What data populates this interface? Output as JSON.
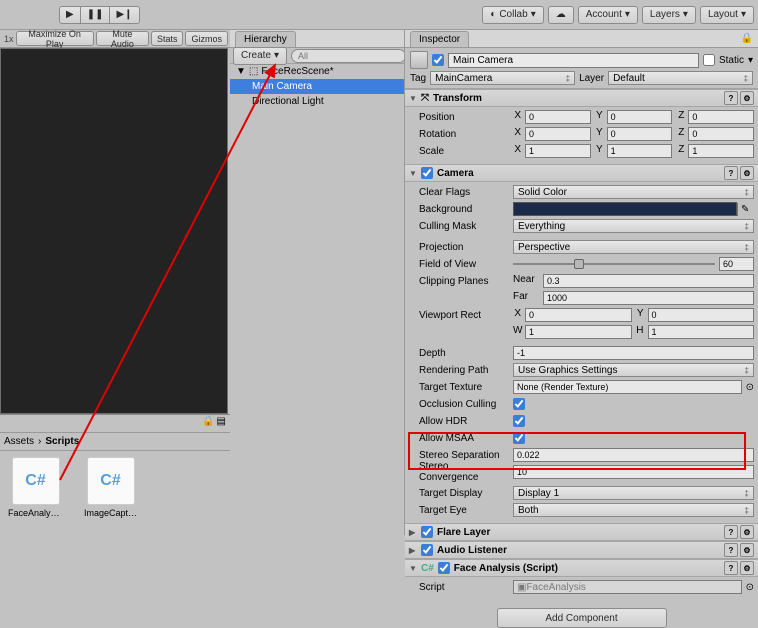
{
  "topbar": {
    "collab": "Collab",
    "account": "Account",
    "layers": "Layers",
    "layout": "Layout"
  },
  "gamebar": {
    "scale": "1x",
    "maximize": "Maximize On Play",
    "mute": "Mute Audio",
    "stats": "Stats",
    "gizmos": "Gizmos"
  },
  "hierarchy": {
    "tab": "Hierarchy",
    "create": "Create",
    "search_ph": "All",
    "scene": "FaceRecScene*",
    "items": [
      "Main Camera",
      "Directional Light"
    ]
  },
  "assets": {
    "crumb0": "Assets",
    "crumb1": "Scripts",
    "items": [
      "FaceAnalys…",
      "ImageCapt…"
    ]
  },
  "inspector": {
    "tab": "Inspector",
    "name": "Main Camera",
    "static": "Static",
    "tagLabel": "Tag",
    "tagValue": "MainCamera",
    "layerLabel": "Layer",
    "layerValue": "Default",
    "transform": {
      "title": "Transform",
      "posLabel": "Position",
      "pos": {
        "x": "0",
        "y": "0",
        "z": "0"
      },
      "rotLabel": "Rotation",
      "rot": {
        "x": "0",
        "y": "0",
        "z": "0"
      },
      "sclLabel": "Scale",
      "scl": {
        "x": "1",
        "y": "1",
        "z": "1"
      }
    },
    "camera": {
      "title": "Camera",
      "clearFlagsLabel": "Clear Flags",
      "clearFlags": "Solid Color",
      "backgroundLabel": "Background",
      "cullingLabel": "Culling Mask",
      "culling": "Everything",
      "projLabel": "Projection",
      "proj": "Perspective",
      "fovLabel": "Field of View",
      "fov": "60",
      "clipLabel": "Clipping Planes",
      "nearL": "Near",
      "near": "0.3",
      "farL": "Far",
      "far": "1000",
      "viewportLabel": "Viewport Rect",
      "vx": "0",
      "vy": "0",
      "vw": "1",
      "vh": "1",
      "depthLabel": "Depth",
      "depth": "-1",
      "renderPathLabel": "Rendering Path",
      "renderPath": "Use Graphics Settings",
      "targetTexLabel": "Target Texture",
      "targetTex": "None (Render Texture)",
      "occLabel": "Occlusion Culling",
      "hdrLabel": "Allow HDR",
      "msaaLabel": "Allow MSAA",
      "stereoSepLabel": "Stereo Separation",
      "stereoSep": "0.022",
      "stereoConvLabel": "Stereo Convergence",
      "stereoConv": "10",
      "targetDispLabel": "Target Display",
      "targetDisp": "Display 1",
      "targetEyeLabel": "Target Eye",
      "targetEye": "Both"
    },
    "flare": {
      "title": "Flare Layer"
    },
    "audio": {
      "title": "Audio Listener"
    },
    "faceScript": {
      "title": "Face Analysis (Script)",
      "scriptLabel": "Script",
      "scriptVal": "FaceAnalysis"
    },
    "addComponent": "Add Component"
  }
}
